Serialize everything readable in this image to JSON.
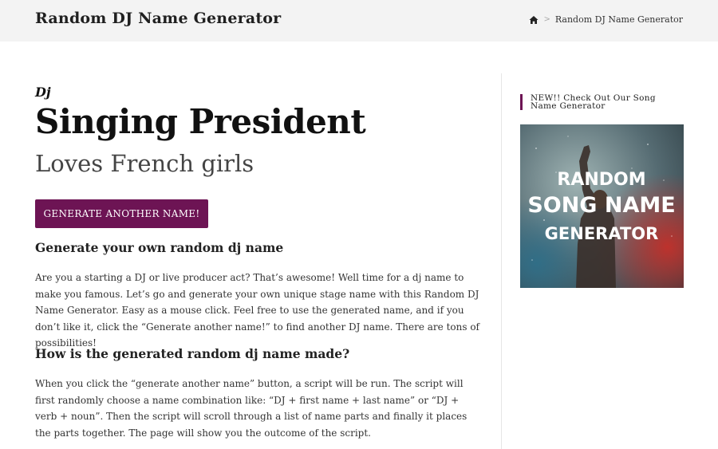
{
  "header": {
    "site_title": "Random DJ Name Generator",
    "breadcrumb": {
      "home_icon": "home-icon",
      "separator": ">",
      "current": "Random DJ Name Generator"
    }
  },
  "result": {
    "prefix": "Dj",
    "name": "Singing President",
    "tagline": "Loves French girls"
  },
  "generate_button_label": "GENERATE ANOTHER NAME!",
  "sections": [
    {
      "heading": "Generate your own random dj name",
      "body": "Are you a starting a DJ or live producer act? That’s awesome! Well time for a dj name to make you famous. Let’s go and generate your own unique stage name with this Random DJ Name Generator. Easy as a mouse click. Feel free to use the generated name, and if you don’t like it, click the “Generate another name!” to find another DJ name. There are tons of possibilities!"
    },
    {
      "heading": "How is the generated random dj name made?",
      "body": "When you click the “generate another name” button, a script will be run. The script will first randomly choose a name combination like: “DJ + first name + last name” or “DJ + verb + noun”. Then the script will scroll through a list of name parts and finally it places the parts together. The page will show you the outcome of the script."
    }
  ],
  "sidebar": {
    "heading": "NEW!! Check Out Our Song Name Generator",
    "promo": {
      "line1": "RANDOM",
      "line2": "SONG NAME",
      "line3": "GENERATOR"
    }
  },
  "colors": {
    "accent": "#6d1454",
    "topbar_bg": "#f3f3f3"
  }
}
